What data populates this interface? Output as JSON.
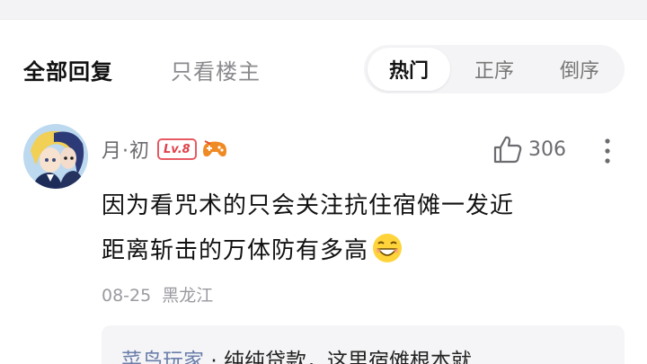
{
  "filters": {
    "all_replies": "全部回复",
    "op_only": "只看楼主"
  },
  "sort": {
    "items": [
      "热门",
      "正序",
      "倒序"
    ],
    "active": "热门"
  },
  "comment": {
    "username": "月·初",
    "level": "Lv.8",
    "likes": "306",
    "content_line1": "因为看咒术的只会关注抗住宿傩一发近",
    "content_line2": "距离斩击的万体防有多高",
    "date": "08-25",
    "location": "黑龙江"
  },
  "reply_preview": {
    "user": "菜鸟玩家",
    "separator": "·",
    "text": "纯纯贷款，这里宿傩根本就"
  },
  "icons": {
    "like": "thumbs-up-icon",
    "more": "vertical-ellipsis-icon",
    "game": "gamepad-icon",
    "emoji": "grinning-emoji-icon"
  },
  "colors": {
    "level_badge": "#e0404b",
    "reply_user": "#6a7eaa",
    "secondary_text": "#6b6b70"
  }
}
